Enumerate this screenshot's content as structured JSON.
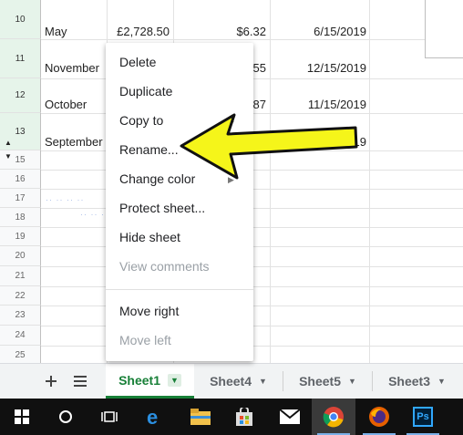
{
  "grid": {
    "rows": [
      {
        "num": "10",
        "month": "May",
        "amount": "£2,728.50",
        "fee": "$6.32",
        "date": "6/15/2019"
      },
      {
        "num": "11",
        "month": "November",
        "amount": "",
        "fee": "55",
        "date": "12/15/2019"
      },
      {
        "num": "12",
        "month": "October",
        "amount": "",
        "fee": "87",
        "date": "11/15/2019"
      },
      {
        "num": "13",
        "month": "September",
        "amount": "",
        "fee": "",
        "date": "10/15/2019"
      },
      {
        "num": "15"
      },
      {
        "num": "16"
      },
      {
        "num": "17"
      },
      {
        "num": "18"
      },
      {
        "num": "19"
      },
      {
        "num": "20"
      },
      {
        "num": "21"
      },
      {
        "num": "22"
      },
      {
        "num": "23"
      },
      {
        "num": "24"
      },
      {
        "num": "25"
      }
    ]
  },
  "context_menu": {
    "items": [
      {
        "label": "Delete",
        "enabled": true
      },
      {
        "label": "Duplicate",
        "enabled": true
      },
      {
        "label": "Copy to",
        "enabled": true,
        "submenu": true
      },
      {
        "label": "Rename...",
        "enabled": true
      },
      {
        "label": "Change color",
        "enabled": true,
        "submenu": true
      },
      {
        "label": "Protect sheet...",
        "enabled": true
      },
      {
        "label": "Hide sheet",
        "enabled": true
      },
      {
        "label": "View comments",
        "enabled": false
      },
      {
        "label": "Move right",
        "enabled": true
      },
      {
        "label": "Move left",
        "enabled": false
      }
    ]
  },
  "sheet_tabs": {
    "add_icon": "plus-icon",
    "list_icon": "list-icon",
    "tabs": [
      {
        "label": "Sheet1",
        "active": true
      },
      {
        "label": "Sheet4",
        "active": false
      },
      {
        "label": "Sheet5",
        "active": false
      },
      {
        "label": "Sheet3",
        "active": false
      }
    ]
  },
  "taskbar": {
    "icons": [
      "windows-start-icon",
      "search-circle-icon",
      "task-view-icon",
      "edge-icon",
      "file-explorer-icon",
      "store-icon",
      "mail-icon",
      "chrome-icon",
      "firefox-icon",
      "photoshop-icon"
    ],
    "photoshop_label": "Ps"
  },
  "colors": {
    "accent_green": "#188038",
    "highlight_arrow": "#f5f51a",
    "taskbar": "#101010"
  }
}
